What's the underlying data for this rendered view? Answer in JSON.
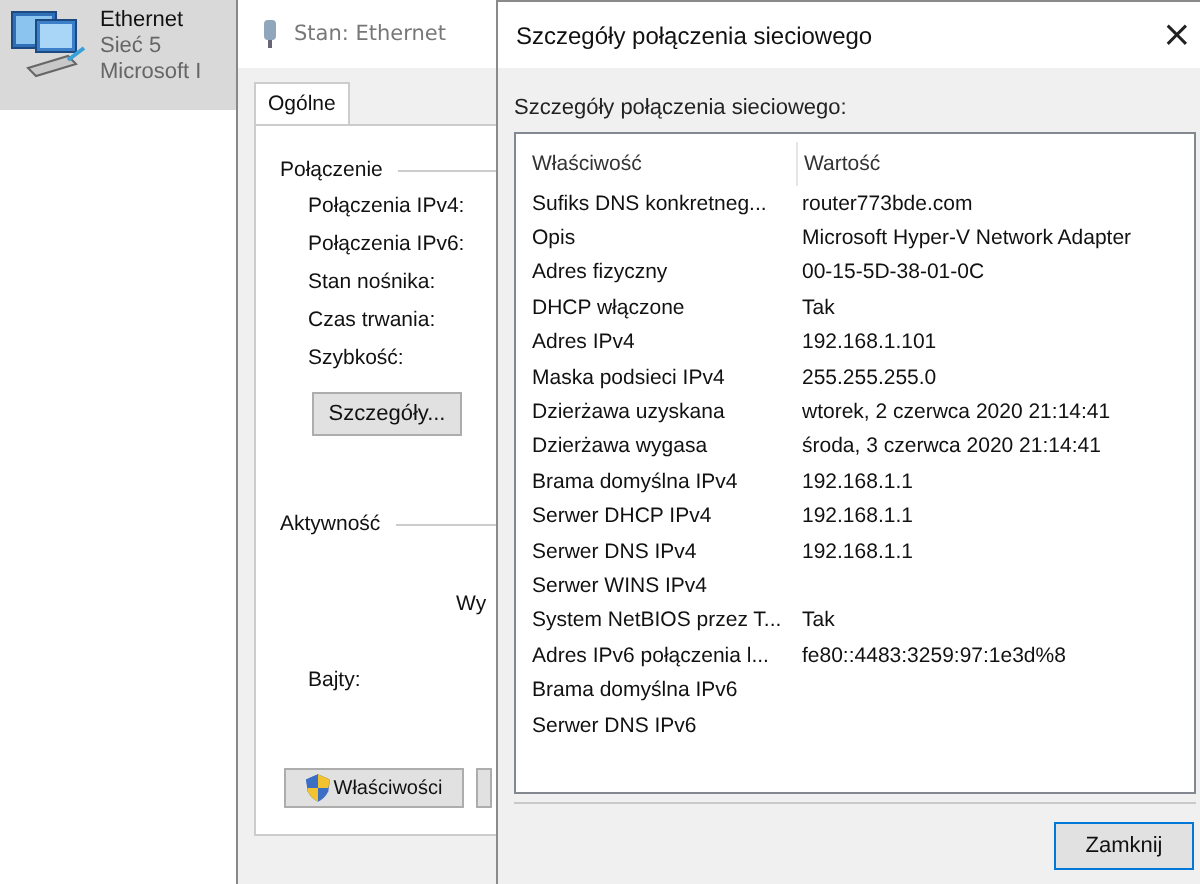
{
  "adapter": {
    "name": "Ethernet",
    "network": "Sieć 5",
    "device": "Microsoft I"
  },
  "status_window": {
    "title": "Stan: Ethernet",
    "tabs": [
      {
        "label": "Ogólne",
        "selected": true
      }
    ],
    "connection": {
      "heading": "Połączenie",
      "labels": [
        "Połączenia IPv4:",
        "Połączenia IPv6:",
        "Stan nośnika:",
        "Czas trwania:",
        "Szybkość:"
      ],
      "details_button": "Szczegóły..."
    },
    "activity": {
      "heading": "Aktywność",
      "column_1": "Wy",
      "bytes_label": "Bajty:"
    },
    "buttons": [
      "Właściwości"
    ]
  },
  "details_dialog": {
    "title": "Szczegóły połączenia sieciowego",
    "close": "×",
    "caption": "Szczegóły połączenia sieciowego:",
    "columns": [
      "Właściwość",
      "Wartość"
    ],
    "rows": [
      [
        "Sufiks DNS konkretneg...",
        "router773bde.com"
      ],
      [
        "Opis",
        "Microsoft Hyper-V Network Adapter"
      ],
      [
        "Adres fizyczny",
        "00-15-5D-38-01-0C"
      ],
      [
        "DHCP włączone",
        "Tak"
      ],
      [
        "Adres IPv4",
        "192.168.1.101"
      ],
      [
        "Maska podsieci IPv4",
        "255.255.255.0"
      ],
      [
        "Dzierżawa uzyskana",
        "wtorek, 2 czerwca 2020 21:14:41"
      ],
      [
        "Dzierżawa wygasa",
        "środa, 3 czerwca 2020 21:14:41"
      ],
      [
        "Brama domyślna IPv4",
        "192.168.1.1"
      ],
      [
        "Serwer DHCP IPv4",
        "192.168.1.1"
      ],
      [
        "Serwer DNS IPv4",
        "192.168.1.1"
      ],
      [
        "Serwer WINS IPv4",
        ""
      ],
      [
        "System NetBIOS przez T...",
        "Tak"
      ],
      [
        "Adres IPv6 połączenia l...",
        "fe80::4483:3259:97:1e3d%8"
      ],
      [
        "Brama domyślna IPv6",
        ""
      ],
      [
        "Serwer DNS IPv6",
        ""
      ]
    ],
    "close_button": "Zamknij"
  }
}
